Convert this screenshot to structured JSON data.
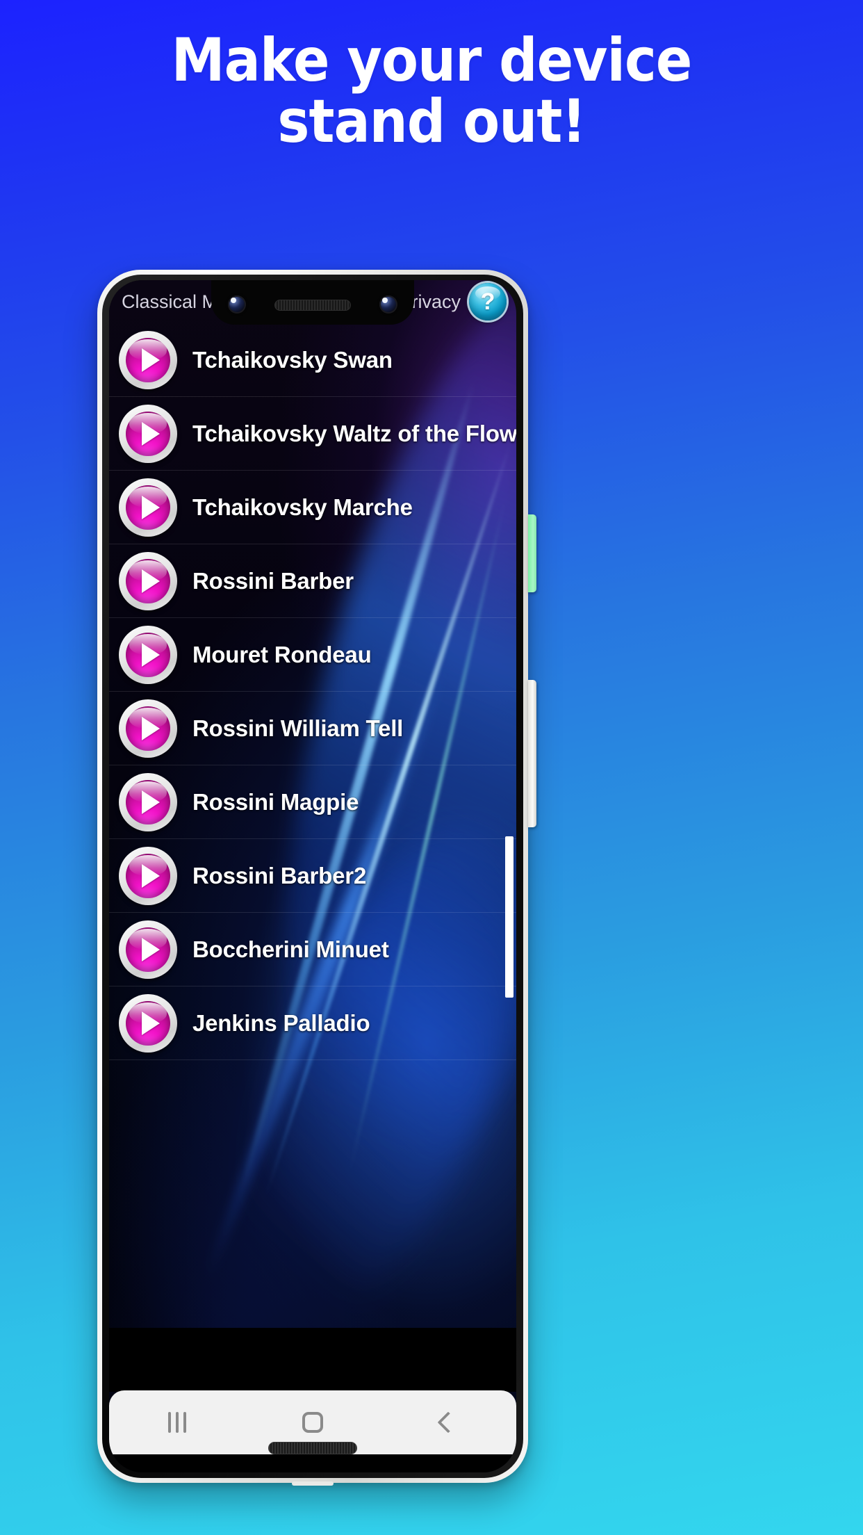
{
  "headline": {
    "line1": "Make your device",
    "line2": "stand out!"
  },
  "theme": {
    "bg_top": "#1c22ff",
    "bg_bottom": "#33d6ee",
    "accent_pink": "#f213c8",
    "help_cyan": "#37bce0",
    "bixby_green": "#8cf2b3"
  },
  "phone": {
    "frame_color": "#f2f2f0",
    "bezel_color": "#101010",
    "hardware": {
      "bixby_button": "bixby-button",
      "volume_rocker": "volume-rocker",
      "speaker_grille": "speaker-grille",
      "earpiece": "earpiece-speaker",
      "camera_left": "front-camera-left",
      "camera_right": "front-camera-right"
    }
  },
  "app": {
    "title": "Classical Music H",
    "privacy_label": "Privacy",
    "help_glyph": "?",
    "songs": [
      {
        "title": "Tchaikovsky Swan",
        "play": "play-icon"
      },
      {
        "title": "Tchaikovsky Waltz of the Flowers",
        "play": "play-icon"
      },
      {
        "title": "Tchaikovsky Marche",
        "play": "play-icon"
      },
      {
        "title": "Rossini Barber",
        "play": "play-icon"
      },
      {
        "title": "Mouret Rondeau",
        "play": "play-icon"
      },
      {
        "title": "Rossini William Tell",
        "play": "play-icon"
      },
      {
        "title": "Rossini Magpie",
        "play": "play-icon"
      },
      {
        "title": "Rossini Barber2",
        "play": "play-icon"
      },
      {
        "title": "Boccherini Minuet",
        "play": "play-icon"
      },
      {
        "title": "Jenkins Palladio",
        "play": "play-icon"
      }
    ]
  },
  "navbar": {
    "recents": "recents-icon",
    "home": "home-icon",
    "back": "back-icon"
  }
}
